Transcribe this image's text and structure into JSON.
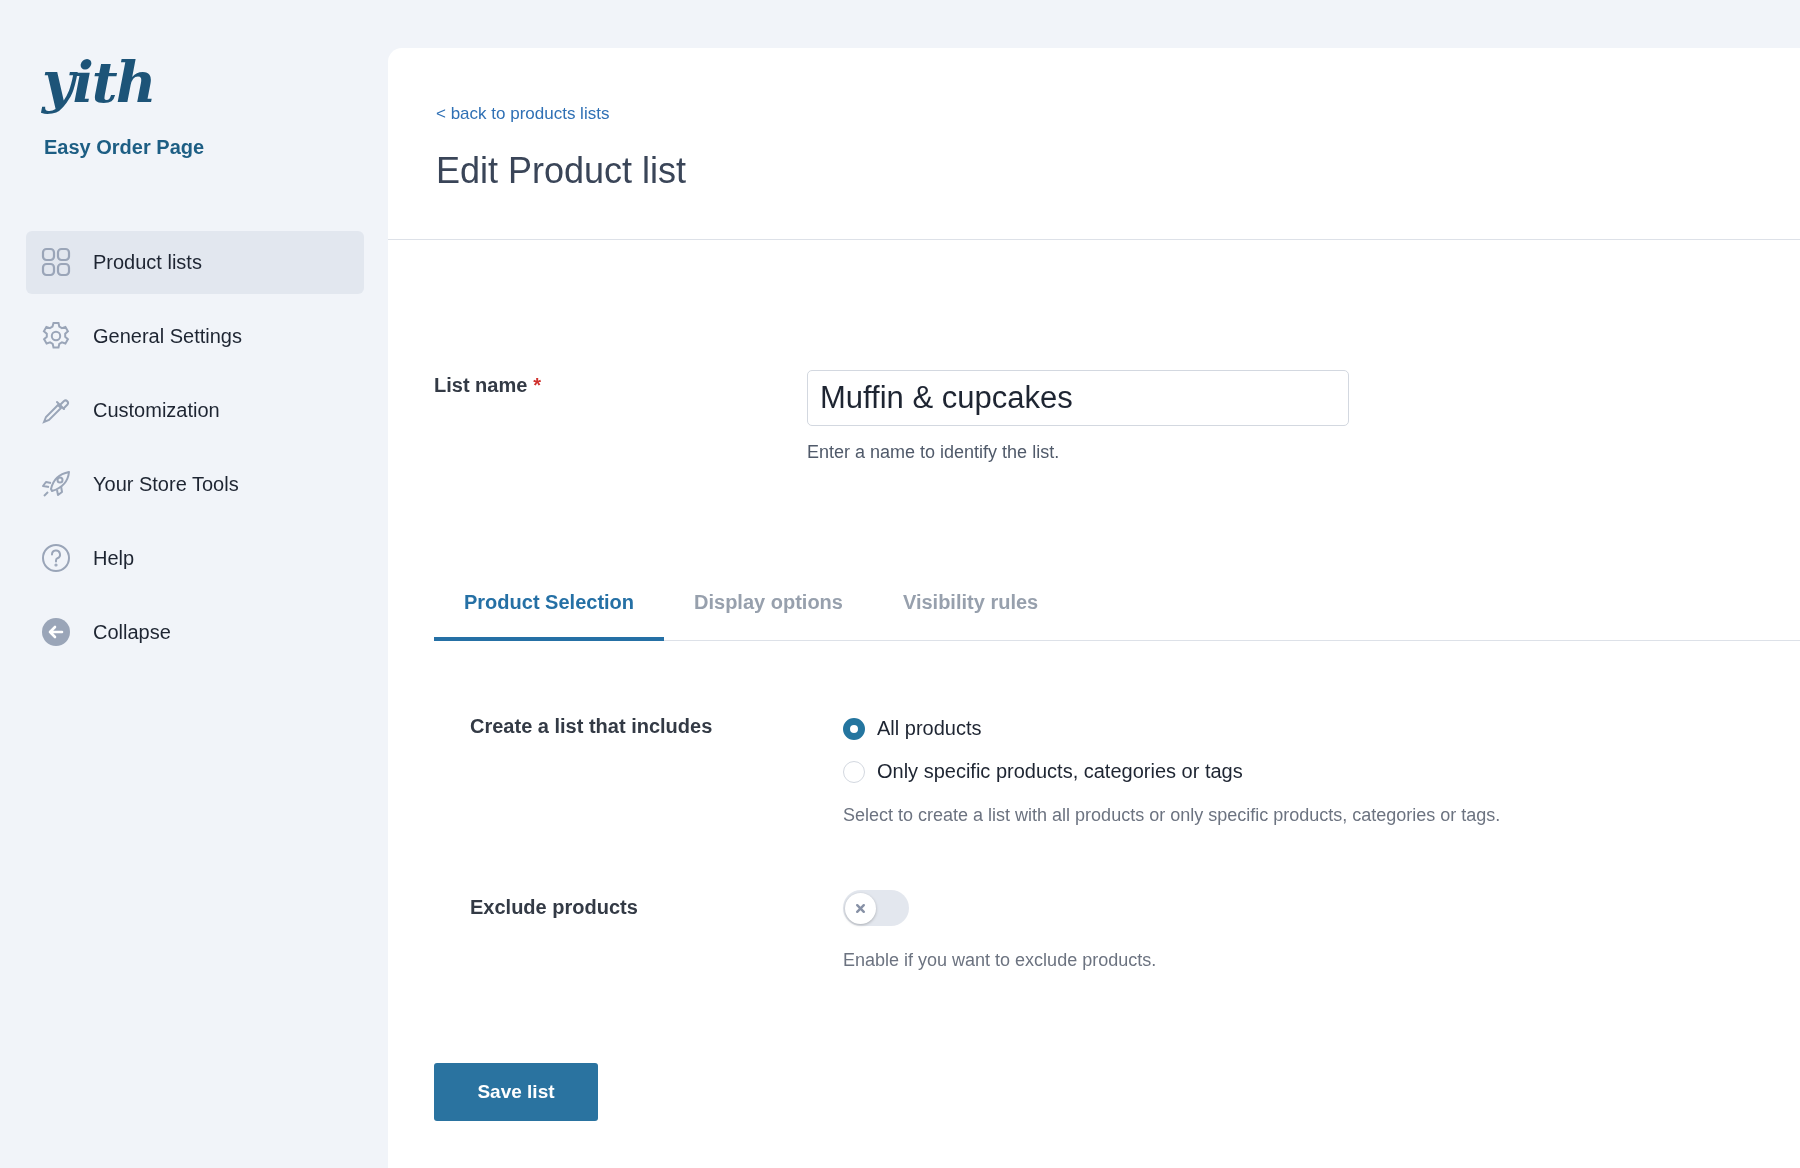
{
  "sidebar": {
    "logo": "yith",
    "product": "Easy Order Page",
    "items": [
      {
        "label": "Product lists",
        "selected": true
      },
      {
        "label": "General Settings",
        "selected": false
      },
      {
        "label": "Customization",
        "selected": false
      },
      {
        "label": "Your Store Tools",
        "selected": false
      },
      {
        "label": "Help",
        "selected": false
      },
      {
        "label": "Collapse",
        "selected": false
      }
    ]
  },
  "header": {
    "back_link": "< back to products lists",
    "title": "Edit Product list"
  },
  "list_name": {
    "label": "List name",
    "required_mark": "*",
    "value": "Muffin & cupcakes",
    "hint": "Enter a name to identify the list."
  },
  "tabs": [
    {
      "label": "Product Selection",
      "selected": true
    },
    {
      "label": "Display options",
      "selected": false
    },
    {
      "label": "Visibility rules",
      "selected": false
    }
  ],
  "fields": [
    {
      "kind": "radio",
      "label": "Create a list that includes",
      "options": [
        {
          "label": "All products",
          "selected": true
        },
        {
          "label": "Only specific products, categories or tags",
          "selected": false
        }
      ],
      "hint": "Select to create a list with all products or only specific products, categories or tags."
    },
    {
      "kind": "toggle",
      "label": "Exclude products",
      "on": false,
      "hint": "Enable if you want to exclude products."
    }
  ],
  "save_button": "Save list"
}
